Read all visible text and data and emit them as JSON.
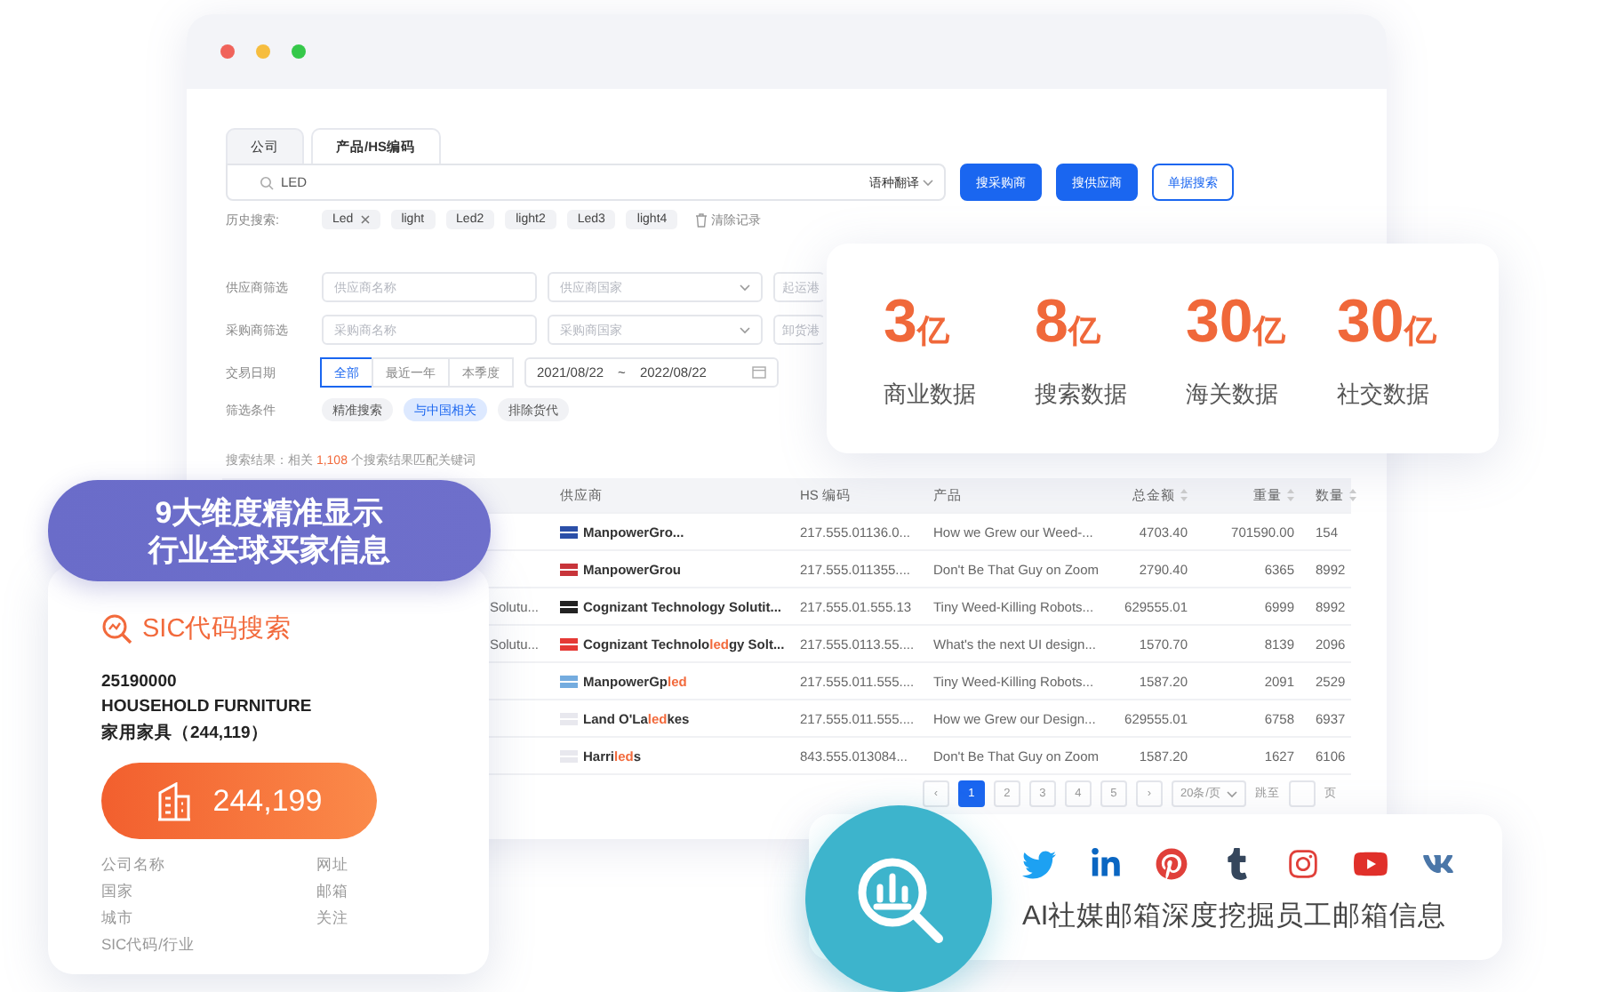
{
  "window": {
    "tabs": [
      {
        "label": "公司",
        "selected": false
      },
      {
        "label": "产品/HS编码",
        "selected": true
      }
    ],
    "search": {
      "value": "LED",
      "language": "语种翻译",
      "buttons": [
        {
          "label": "搜采购商",
          "kind": "primary"
        },
        {
          "label": "搜供应商",
          "kind": "primary"
        },
        {
          "label": "单据搜索",
          "kind": "outline"
        }
      ]
    },
    "history": {
      "label": "历史搜索:",
      "tags": [
        {
          "text": "Led",
          "removable": true
        },
        {
          "text": "light",
          "removable": false
        },
        {
          "text": "Led2",
          "removable": false
        },
        {
          "text": "light2",
          "removable": false
        },
        {
          "text": "Led3",
          "removable": false
        },
        {
          "text": "light4",
          "removable": false
        }
      ],
      "clear": "清除记录"
    },
    "filters": [
      {
        "label": "供应商筛选",
        "fields": [
          {
            "placeholder": "供应商名称",
            "kind": "text"
          },
          {
            "placeholder": "供应商国家",
            "kind": "select"
          },
          {
            "placeholder": "起运港",
            "kind": "text"
          }
        ]
      },
      {
        "label": "采购商筛选",
        "fields": [
          {
            "placeholder": "采购商名称",
            "kind": "text"
          },
          {
            "placeholder": "采购商国家",
            "kind": "select"
          },
          {
            "placeholder": "卸货港",
            "kind": "text"
          }
        ]
      }
    ],
    "date": {
      "label": "交易日期",
      "ranges": [
        {
          "label": "全部",
          "selected": true
        },
        {
          "label": "最近一年",
          "selected": false
        },
        {
          "label": "本季度",
          "selected": false
        }
      ],
      "start": "2021/08/22",
      "separator": "~",
      "end": "2022/08/22"
    },
    "conditions": {
      "label": "筛选条件",
      "chips": [
        {
          "label": "精准搜索",
          "selected": false
        },
        {
          "label": "与中国相关",
          "selected": true
        },
        {
          "label": "排除货代",
          "selected": false
        }
      ]
    },
    "result": {
      "prefix": "搜索结果：相关 ",
      "count": "1,108",
      "suffix": " 个搜索结果匹配关键词"
    },
    "table": {
      "columns": [
        {
          "label": "供应商",
          "sortable": false
        },
        {
          "label": "HS 编码",
          "sortable": false
        },
        {
          "label": "产品",
          "sortable": false
        },
        {
          "label": "总金额",
          "sortable": true
        },
        {
          "label": "重量",
          "sortable": true
        },
        {
          "label": "数量",
          "sortable": true
        }
      ],
      "rows": [
        {
          "color": "#2b4fa8",
          "supplier": [
            {
              "text": "ManpowerGro...",
              "highlight": false
            }
          ],
          "hs": "217.555.01136.0...",
          "product": "How we Grew our Weed-...",
          "total": "4703.40",
          "weight": "701590.00",
          "quantity": "154"
        },
        {
          "color": "#c8343a",
          "supplier": [
            {
              "text": "ManpowerGrou",
              "highlight": false
            }
          ],
          "hs": "217.555.011355....",
          "product": "Don't Be That Guy on Zoom",
          "total": "2790.40",
          "weight": "6365",
          "quantity": "8992"
        },
        {
          "color": "#222222",
          "column_1": "Solutu...",
          "supplier": [
            {
              "text": "Cognizant Technology Solutit...",
              "highlight": false
            }
          ],
          "hs": "217.555.01.555.13",
          "product": "Tiny Weed-Killing Robots...",
          "total": "629555.01",
          "weight": "6999",
          "quantity": "8992"
        },
        {
          "color": "#e53935",
          "column_1": "Solutu...",
          "supplier": [
            {
              "text": "Cognizant Technolo",
              "highlight": false
            },
            {
              "text": "led",
              "highlight": true
            },
            {
              "text": "gy Solt...",
              "highlight": false
            }
          ],
          "hs": "217.555.0113.55....",
          "product": "What's the next UI design...",
          "total": "1570.70",
          "weight": "8139",
          "quantity": "2096"
        },
        {
          "color": "#74acdf",
          "supplier": [
            {
              "text": "ManpowerGp",
              "highlight": false
            },
            {
              "text": "led",
              "highlight": true
            }
          ],
          "hs": "217.555.011.555....",
          "product": "Tiny Weed-Killing Robots...",
          "total": "1587.20",
          "weight": "2091",
          "quantity": "2529"
        },
        {
          "color": "#e8e8ee",
          "supplier": [
            {
              "text": "Land O'La",
              "highlight": false
            },
            {
              "text": "led",
              "highlight": true
            },
            {
              "text": "kes",
              "highlight": false
            }
          ],
          "hs": "217.555.011.555....",
          "product": "How we Grew our Design...",
          "total": "629555.01",
          "weight": "6758",
          "quantity": "6937"
        },
        {
          "color": "#e8e8ee",
          "supplier": [
            {
              "text": "Harri",
              "highlight": false
            },
            {
              "text": "led",
              "highlight": true
            },
            {
              "text": "s",
              "highlight": false
            }
          ],
          "hs": "843.555.013084...",
          "product": "Don't Be That Guy on Zoom",
          "total": "1587.20",
          "weight": "1627",
          "quantity": "6106"
        }
      ]
    },
    "pagination": {
      "prev": "‹",
      "pages": [
        {
          "label": "1",
          "selected": true
        },
        {
          "label": "2",
          "selected": false
        },
        {
          "label": "3",
          "selected": false
        },
        {
          "label": "4",
          "selected": false
        },
        {
          "label": "5",
          "selected": false
        }
      ],
      "next": "›",
      "page_size": "20条/页",
      "jump_label": "跳至",
      "jump_suffix": "页"
    }
  },
  "stats": [
    {
      "value": "3",
      "unit": "亿",
      "label": "商业数据"
    },
    {
      "value": "8",
      "unit": "亿",
      "label": "搜索数据"
    },
    {
      "value": "30",
      "unit": "亿",
      "label": "海关数据"
    },
    {
      "value": "30",
      "unit": "亿",
      "label": "社交数据"
    }
  ],
  "banner": {
    "lines": [
      "9大维度精准显示",
      "行业全球买家信息"
    ]
  },
  "sic_card": {
    "title": "SIC代码搜索",
    "code": "25190000",
    "industry": "HOUSEHOLD FURNITURE",
    "industry_cn": "家用家具（244,119）",
    "count": "244,199",
    "fields": [
      "公司名称",
      "网址",
      "国家",
      "邮箱",
      "城市",
      "关注",
      "SIC代码/行业"
    ]
  },
  "social": {
    "text": "AI社媒邮箱深度挖掘员工邮箱信息"
  }
}
